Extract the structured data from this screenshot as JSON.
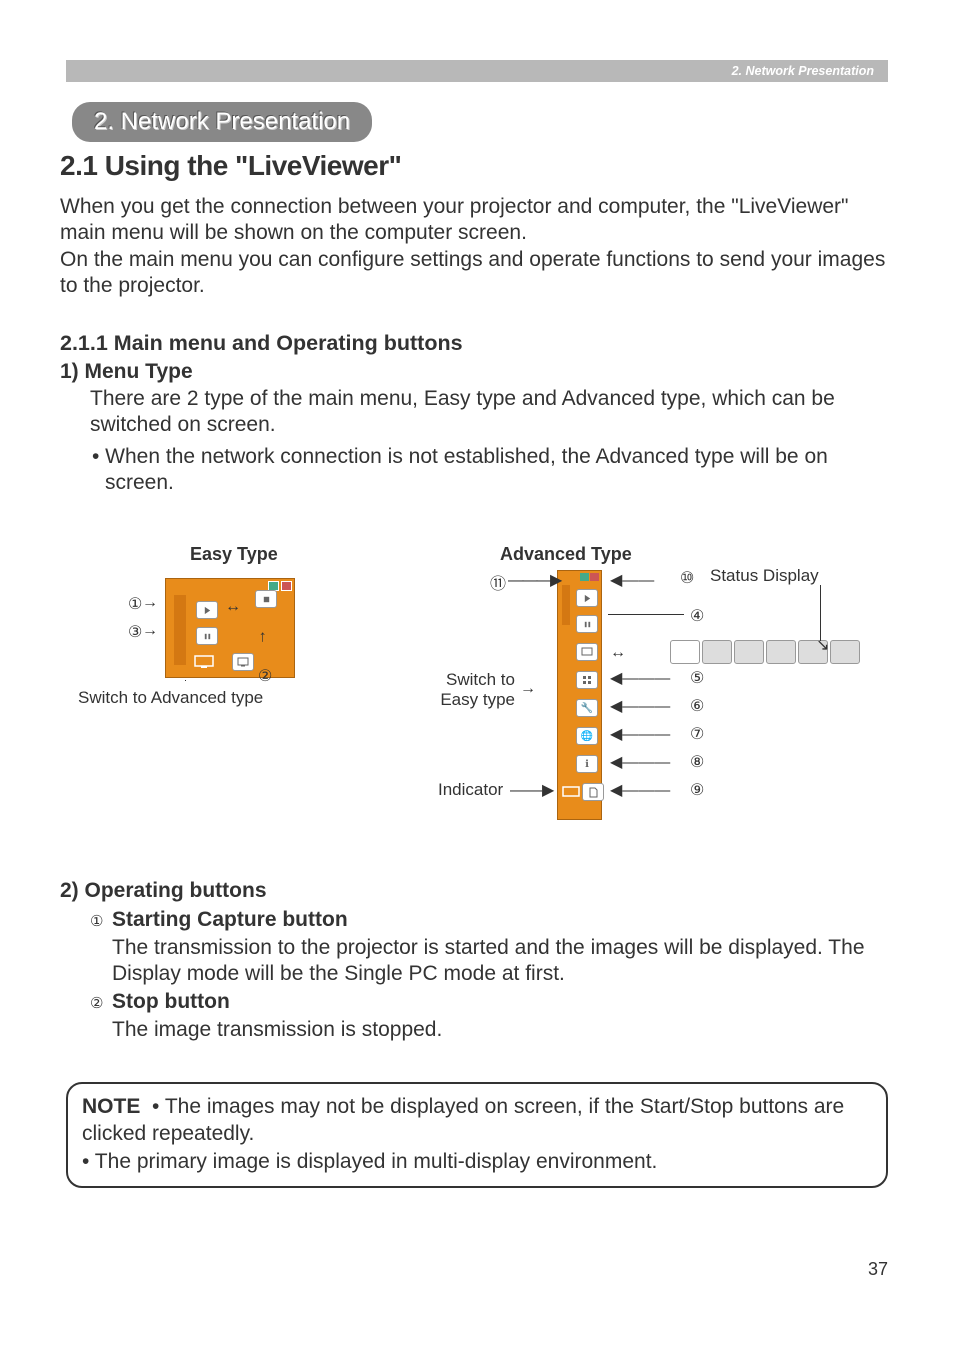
{
  "header": {
    "breadcrumb": "2. Network Presentation"
  },
  "pill": {
    "text": "2. Network Presentation"
  },
  "heading_main": "2.1 Using the \"LiveViewer\"",
  "intro": "When you get the connection between your projector and computer, the \"LiveViewer\" main menu will be shown on the computer screen.\nOn the main menu you can configure settings and operate functions to send your images to the projector.",
  "subheading_1": "2.1.1 Main menu and Operating buttons",
  "section1_title": "1) Menu Type",
  "section1_body": "There are 2 type of the main menu, Easy type and Advanced type, which can be switched on screen.",
  "section1_bullet": "• When the network connection is not established, the Advanced type will be on screen.",
  "figure": {
    "easy_label": "Easy Type",
    "advanced_label": "Advanced Type",
    "switch_adv": "Switch to Advanced type",
    "switch_easy": "Switch to Easy type",
    "indicator": "Indicator",
    "status_display": "Status Display",
    "callouts": {
      "c1": "①",
      "c2": "②",
      "c3": "③",
      "c4": "④",
      "c5": "⑤",
      "c6": "⑥",
      "c7": "⑦",
      "c8": "⑧",
      "c9": "⑨",
      "c10": "⑩",
      "c11": "⑪"
    }
  },
  "section2_title": "2) Operating buttons",
  "item1": {
    "num": "①",
    "head": "Starting Capture button",
    "body": "The transmission to the projector is started and the images will be displayed. The Display mode will be the Single PC mode at first."
  },
  "item2": {
    "num": "②",
    "head": "Stop button",
    "body": "The image transmission is stopped."
  },
  "note": {
    "kw": "NOTE",
    "line1": "• The images may not be displayed on screen, if the Start/Stop buttons are clicked repeatedly.",
    "line2": "• The primary image is displayed in multi-display environment."
  },
  "page_number": "37"
}
